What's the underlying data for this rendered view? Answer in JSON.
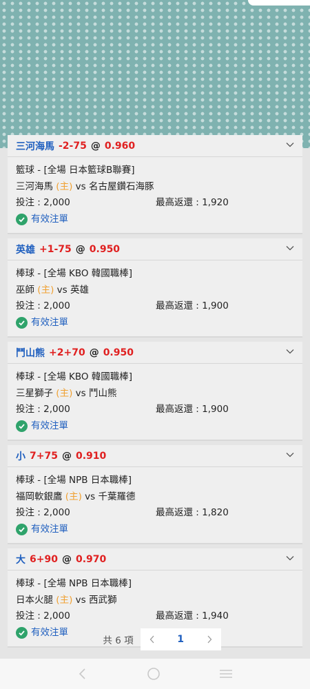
{
  "bets": [
    {
      "team": "三河海馬",
      "line": "-2-75",
      "at": "@",
      "odds": "0.960",
      "league": "籃球 - [全場 日本籃球B聯賽]",
      "home_team": "三河海馬",
      "home_tag": "(主)",
      "vs": "vs",
      "away_team": "名古屋鑽石海豚",
      "stake_label": "投注 : 2,000",
      "max_return_label": "最高返還 : 1,920",
      "status": "有效注單"
    },
    {
      "team": "英雄",
      "line": "+1-75",
      "at": "@",
      "odds": "0.950",
      "league": "棒球 - [全場 KBO 韓國職棒]",
      "home_team": "巫師",
      "home_tag": "(主)",
      "vs": "vs",
      "away_team": "英雄",
      "stake_label": "投注 : 2,000",
      "max_return_label": "最高返還 : 1,900",
      "status": "有效注單"
    },
    {
      "team": "鬥山熊",
      "line": "+2+70",
      "at": "@",
      "odds": "0.950",
      "league": "棒球 - [全場 KBO 韓國職棒]",
      "home_team": "三星獅子",
      "home_tag": "(主)",
      "vs": "vs",
      "away_team": "鬥山熊",
      "stake_label": "投注 : 2,000",
      "max_return_label": "最高返還 : 1,900",
      "status": "有效注單"
    },
    {
      "team": "小",
      "line": "7+75",
      "at": "@",
      "odds": "0.910",
      "league": "棒球 - [全場 NPB 日本職棒]",
      "home_team": "福岡軟銀鷹",
      "home_tag": "(主)",
      "vs": "vs",
      "away_team": "千葉羅德",
      "stake_label": "投注 : 2,000",
      "max_return_label": "最高返還 : 1,820",
      "status": "有效注單"
    },
    {
      "team": "大",
      "line": "6+90",
      "at": "@",
      "odds": "0.970",
      "league": "棒球 - [全場 NPB 日本職棒]",
      "home_team": "日本火腿",
      "home_tag": "(主)",
      "vs": "vs",
      "away_team": "西武獅",
      "stake_label": "投注 : 2,000",
      "max_return_label": "最高返還 : 1,940",
      "status": "有效注單"
    }
  ],
  "pager": {
    "total": "共 6 項",
    "current": "1",
    "prev": "‹",
    "next": "›"
  },
  "colors": {
    "team": "#1f5fbf",
    "odds": "#e02020",
    "home_tag": "#f0a030",
    "check": "#2fa36b"
  },
  "icons": {
    "expand": "chevron-down-icon",
    "valid": "check-circle-icon"
  }
}
